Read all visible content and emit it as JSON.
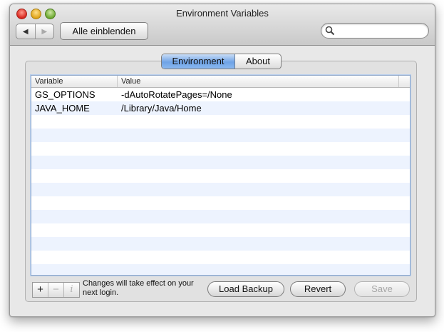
{
  "window": {
    "title": "Environment Variables"
  },
  "toolbar": {
    "show_all_label": "Alle einblenden",
    "back_glyph": "◀",
    "forward_glyph": "▶",
    "search_placeholder": ""
  },
  "tabs": [
    {
      "label": "Environment",
      "selected": true
    },
    {
      "label": "About",
      "selected": false
    }
  ],
  "table": {
    "columns": [
      "Variable",
      "Value"
    ],
    "rows": [
      {
        "variable": "GS_OPTIONS",
        "value": "-dAutoRotatePages=/None"
      },
      {
        "variable": "JAVA_HOME",
        "value": "/Library/Java/Home"
      },
      {
        "variable": "",
        "value": ""
      },
      {
        "variable": "",
        "value": ""
      },
      {
        "variable": "",
        "value": ""
      },
      {
        "variable": "",
        "value": ""
      },
      {
        "variable": "",
        "value": ""
      },
      {
        "variable": "",
        "value": ""
      },
      {
        "variable": "",
        "value": ""
      },
      {
        "variable": "",
        "value": ""
      },
      {
        "variable": "",
        "value": ""
      },
      {
        "variable": "",
        "value": ""
      },
      {
        "variable": "",
        "value": ""
      },
      {
        "variable": "",
        "value": ""
      }
    ]
  },
  "bottom": {
    "add_glyph": "+",
    "remove_glyph": "−",
    "info_glyph": "i",
    "note": "Changes will take effect on your next login.",
    "load_backup_label": "Load Backup",
    "revert_label": "Revert",
    "save_label": "Save"
  },
  "colors": {
    "selected_tab": "#6fa3e6",
    "alternate_row": "#edf3fe",
    "close": "#d8261d",
    "minimize": "#e0a419",
    "zoom": "#6ca930"
  }
}
